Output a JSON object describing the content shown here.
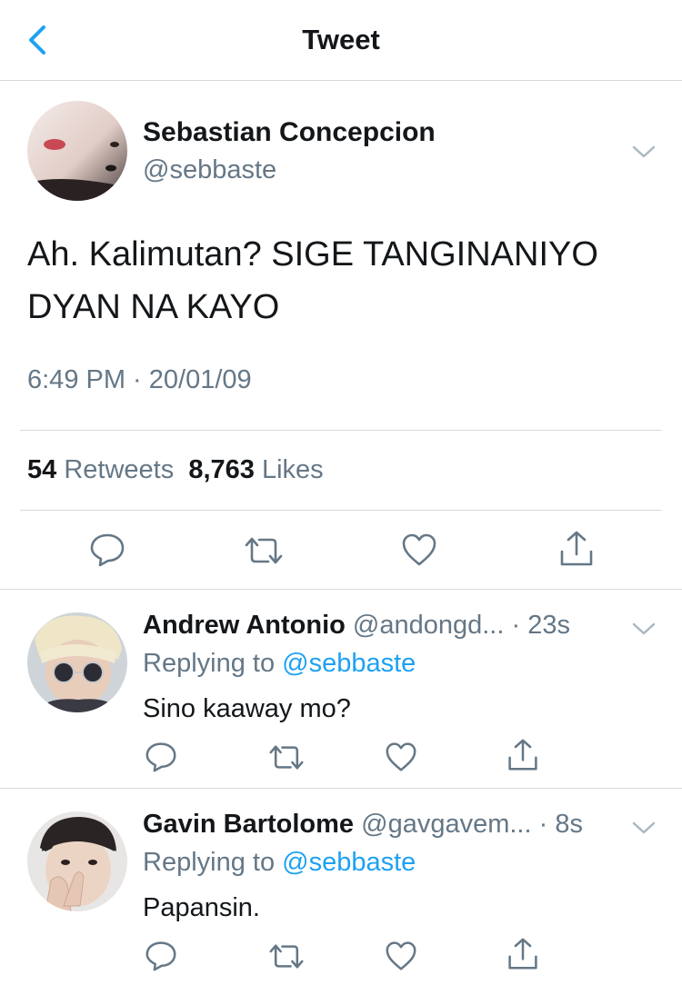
{
  "header": {
    "title": "Tweet",
    "back_icon": "chevron-left-icon"
  },
  "tweet": {
    "author_name": "Sebastian Concepcion",
    "author_handle": "@sebbaste",
    "text": "Ah. Kalimutan? SIGE TANGINANIYO DYAN NA KAYO",
    "timestamp": "6:49 PM · 20/01/09",
    "retweets": {
      "count": "54",
      "label": "Retweets"
    },
    "likes": {
      "count": "8,763",
      "label": "Likes"
    }
  },
  "replies": [
    {
      "name": "Andrew Antonio",
      "handle": "@andongd...",
      "time": "· 23s",
      "replying_prefix": "Replying to",
      "replying_to": "@sebbaste",
      "text": "Sino kaaway mo?"
    },
    {
      "name": "Gavin Bartolome",
      "handle": "@gavgavem...",
      "time": "· 8s",
      "replying_prefix": "Replying to",
      "replying_to": "@sebbaste",
      "text": "Papansin."
    }
  ],
  "icons": {
    "reply": "reply-icon",
    "retweet": "retweet-icon",
    "like": "heart-icon",
    "share": "share-icon",
    "more": "chevron-down-icon"
  },
  "colors": {
    "accent": "#1da1f2",
    "text_primary": "#14171a",
    "text_secondary": "#657786",
    "divider": "#d6d9dc"
  }
}
